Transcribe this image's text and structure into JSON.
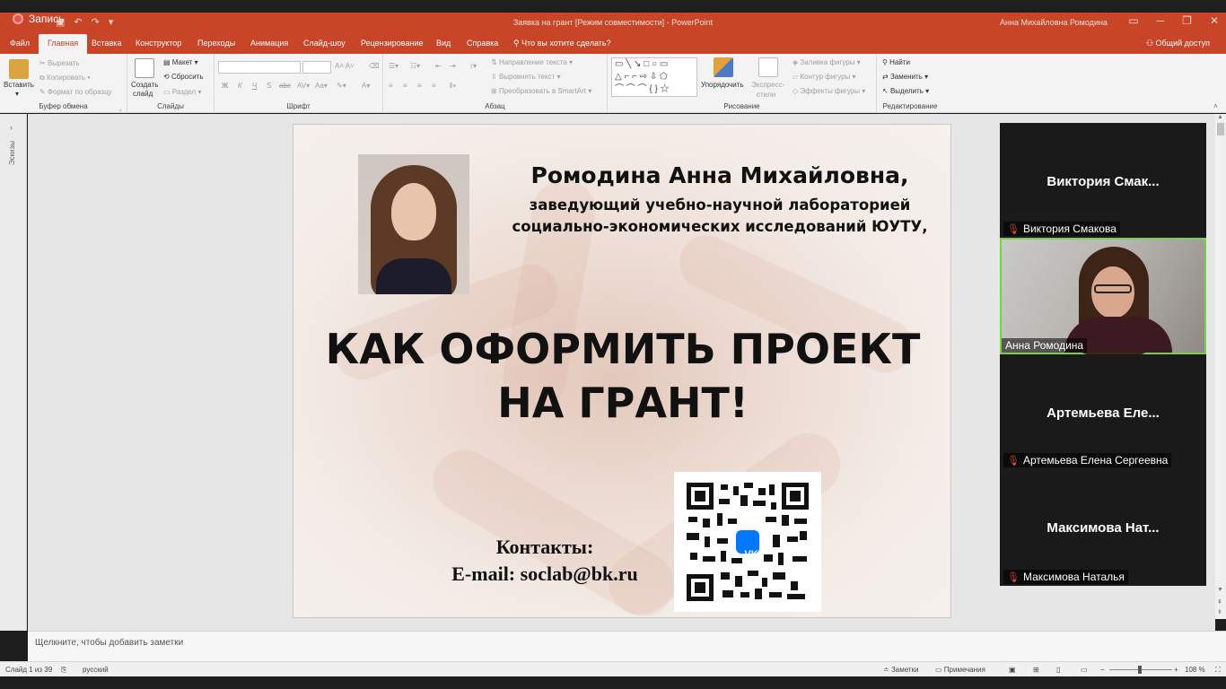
{
  "recording": {
    "label": "Запись"
  },
  "window": {
    "title": "Заявка на грант [Режим совместимости] - PowerPoint",
    "user": "Анна Михайловна Ромодина",
    "controls": [
      "▭",
      "─",
      "❐",
      "✕"
    ]
  },
  "tabs": [
    {
      "label": "Файл"
    },
    {
      "label": "Главная"
    },
    {
      "label": "Вставка"
    },
    {
      "label": "Конструктор"
    },
    {
      "label": "Переходы"
    },
    {
      "label": "Анимация"
    },
    {
      "label": "Слайд-шоу"
    },
    {
      "label": "Рецензирование"
    },
    {
      "label": "Вид"
    },
    {
      "label": "Справка"
    },
    {
      "label": "Что вы хотите сделать?"
    }
  ],
  "share": {
    "label": "Общий доступ"
  },
  "ribbon": {
    "clipboard": {
      "paste": "Вставить",
      "cut": "Вырезать",
      "copy": "Копировать",
      "format_painter": "Формат по образцу",
      "group": "Буфер обмена"
    },
    "slides": {
      "new_slide_1": "Создать",
      "new_slide_2": "слайд",
      "layout": "Макет",
      "reset": "Сбросить",
      "section": "Раздел",
      "group": "Слайды"
    },
    "font": {
      "group": "Шрифт"
    },
    "paragraph": {
      "text_direction": "Направление текста",
      "align_text": "Выровнять текст",
      "smartart": "Преобразовать в SmartArt",
      "group": "Абзац"
    },
    "drawing": {
      "arrange": "Упорядочить",
      "quick_styles_1": "Экспресс-",
      "quick_styles_2": "стили",
      "shape_fill": "Заливка фигуры",
      "shape_outline": "Контур фигуры",
      "shape_effects": "Эффекты фигуры",
      "group": "Рисование"
    },
    "editing": {
      "find": "Найти",
      "replace": "Заменить",
      "select": "Выделить",
      "group": "Редактирование"
    }
  },
  "left_pane": {
    "label": "Эскизы"
  },
  "slide": {
    "name": "Ромодина Анна Михайловна,",
    "role_line1": "заведующий учебно-научной лабораторией",
    "role_line2": "социально-экономических исследований ЮУТУ,",
    "title_line1": "КАК ОФОРМИТЬ ПРОЕКТ",
    "title_line2": "НА ГРАНТ!",
    "contacts_label": "Контакты:",
    "email": "E-mail: soclab@bk.ru",
    "qr_badge": "VK"
  },
  "notes": {
    "placeholder": "Щелкните, чтобы добавить заметки"
  },
  "status": {
    "slide_counter": "Слайд 1 из 39",
    "language": "русский",
    "notes_btn": "Заметки",
    "comments_btn": "Примечания",
    "zoom": "108 %"
  },
  "participants": [
    {
      "big": "Виктория  Смак...",
      "label": "Виктория Смакова",
      "muted": true
    },
    {
      "label": "Анна Ромодина",
      "video": true
    },
    {
      "big": "Артемьева  Еле...",
      "label": "Артемьева Елена Сергеевна",
      "muted": true
    },
    {
      "big": "Максимова  Нат...",
      "label": "Максимова Наталья",
      "muted": true
    }
  ]
}
